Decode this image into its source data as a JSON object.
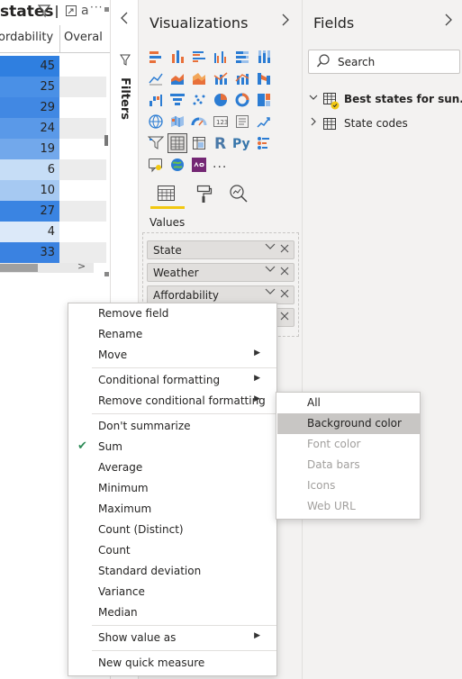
{
  "table": {
    "title": "states",
    "columns": [
      "ordability",
      "Overal"
    ],
    "rows": [
      {
        "value": "45",
        "bg": "#2f7fe0",
        "obg": "#ffffff"
      },
      {
        "value": "25",
        "bg": "#4a90e6",
        "obg": "#ececec"
      },
      {
        "value": "29",
        "bg": "#4188e3",
        "obg": "#ffffff"
      },
      {
        "value": "24",
        "bg": "#5a99e8",
        "obg": "#ececec"
      },
      {
        "value": "19",
        "bg": "#72a8eb",
        "obg": "#ffffff"
      },
      {
        "value": "6",
        "bg": "#c6ddf6",
        "obg": "#ececec"
      },
      {
        "value": "10",
        "bg": "#a6c9f2",
        "obg": "#ffffff"
      },
      {
        "value": "27",
        "bg": "#3a84e2",
        "obg": "#ececec"
      },
      {
        "value": "4",
        "bg": "#dce9f9",
        "obg": "#ffffff"
      },
      {
        "value": "33",
        "bg": "#3a82e1",
        "obg": "#ececec"
      }
    ]
  },
  "filters": {
    "label": "Filters"
  },
  "visualizations": {
    "title": "Visualizations",
    "values_label": "Values",
    "more_label": "...",
    "wells": [
      {
        "label": "State"
      },
      {
        "label": "Weather"
      },
      {
        "label": "Affordability"
      },
      {
        "label": ""
      }
    ]
  },
  "fields": {
    "title": "Fields",
    "search_placeholder": "Search",
    "tables": [
      {
        "label": "Best states for sun..."
      },
      {
        "label": "State codes"
      }
    ]
  },
  "context_menu": {
    "items": [
      {
        "label": "Remove field"
      },
      {
        "label": "Rename"
      },
      {
        "label": "Move"
      },
      {
        "label": "Conditional formatting"
      },
      {
        "label": "Remove conditional formatting"
      },
      {
        "label": "Don't summarize"
      },
      {
        "label": "Sum"
      },
      {
        "label": "Average"
      },
      {
        "label": "Minimum"
      },
      {
        "label": "Maximum"
      },
      {
        "label": "Count (Distinct)"
      },
      {
        "label": "Count"
      },
      {
        "label": "Standard deviation"
      },
      {
        "label": "Variance"
      },
      {
        "label": "Median"
      },
      {
        "label": "Show value as"
      },
      {
        "label": "New quick measure"
      }
    ],
    "checked_item": "Sum"
  },
  "submenu": {
    "items": [
      {
        "label": "All",
        "enabled": true
      },
      {
        "label": "Background color",
        "enabled": true,
        "highlighted": true
      },
      {
        "label": "Font color",
        "enabled": false
      },
      {
        "label": "Data bars",
        "enabled": false
      },
      {
        "label": "Icons",
        "enabled": false
      },
      {
        "label": "Web URL",
        "enabled": false
      }
    ]
  },
  "colors": {
    "accent_yellow": "#f2c811",
    "disabled_text": "#a19f9d",
    "highlight": "#c8c6c4",
    "check_green": "#2e8b57"
  }
}
